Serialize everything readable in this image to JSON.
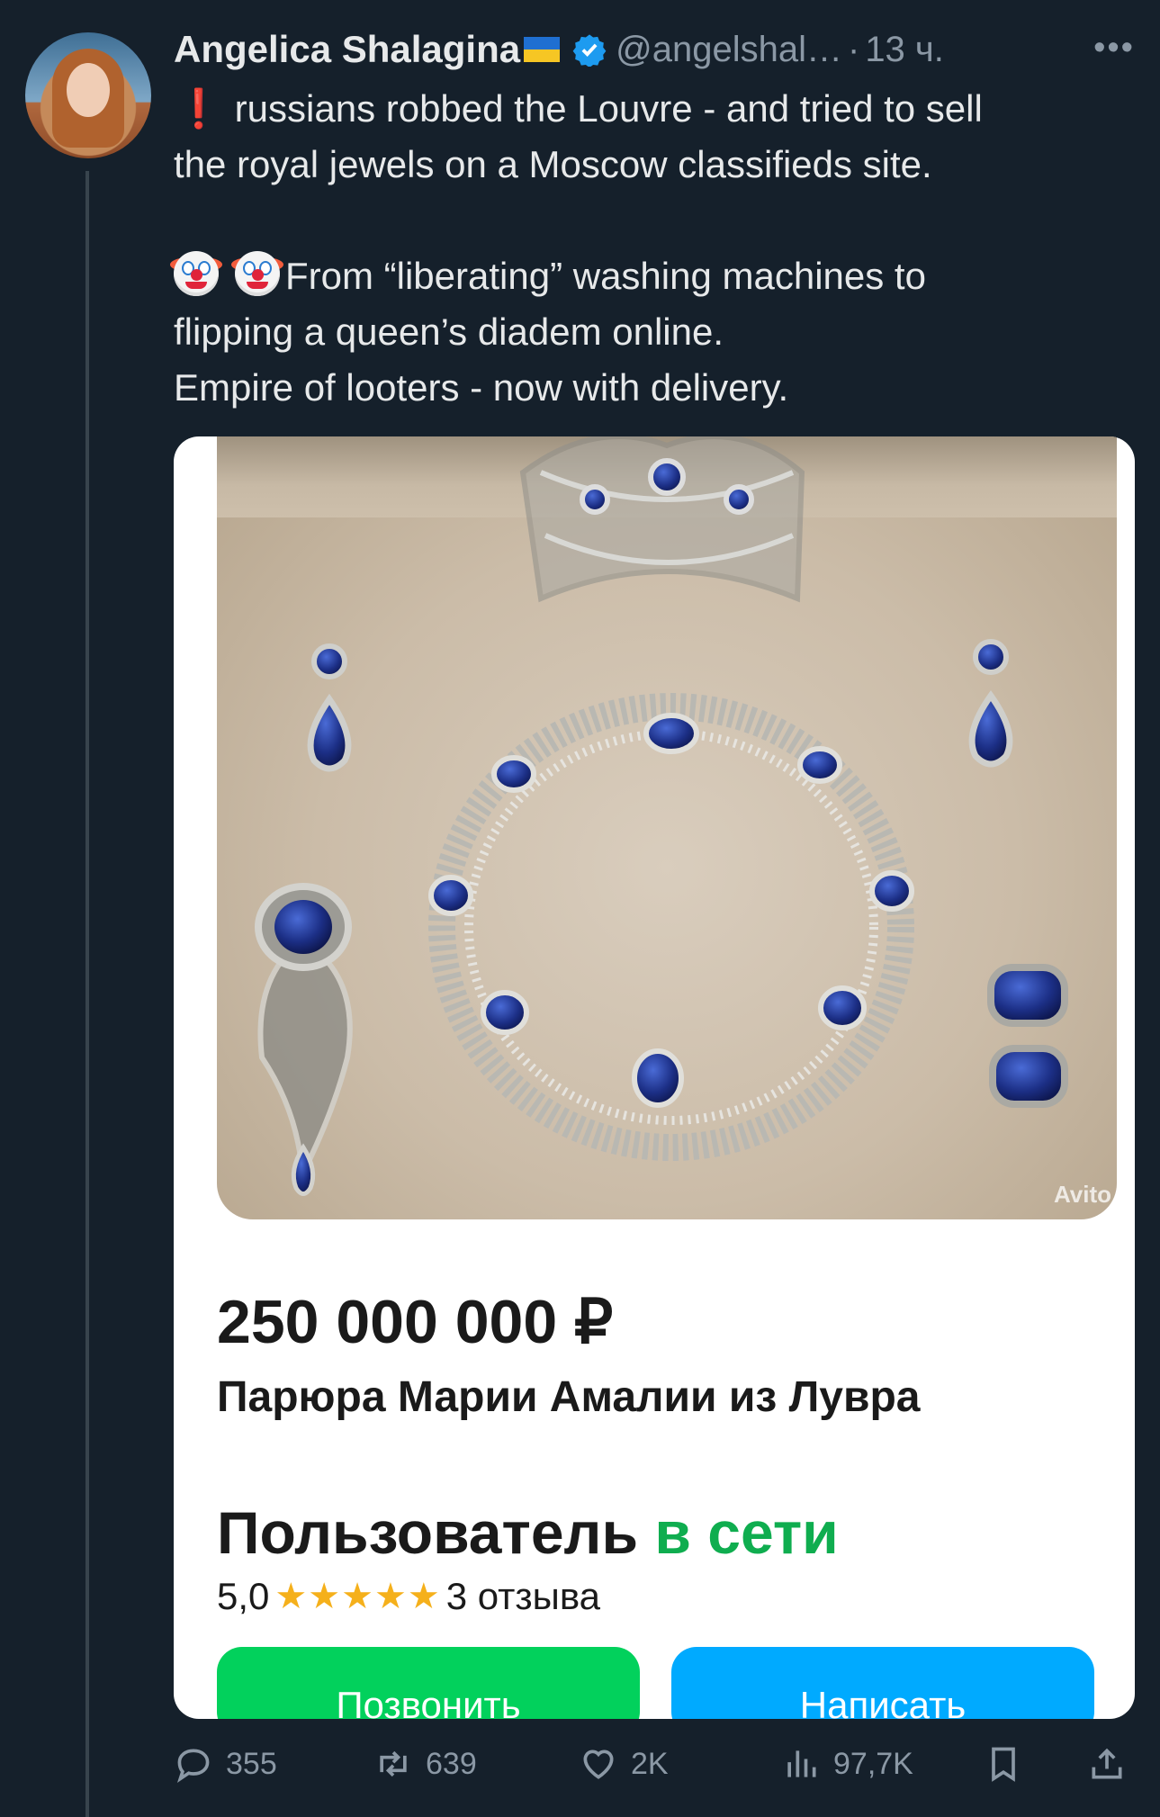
{
  "tweet": {
    "author_name": "Angelica Shalagina",
    "handle": "@angelshal…",
    "time_separator": "·",
    "time": "13 ч.",
    "more_label": "•••",
    "text": {
      "line1_emoji": "❗",
      "line1": "russians robbed the Louvre - and tried to sell",
      "line2": "the royal jewels on a Moscow classifieds site.",
      "line3": "From “liberating” washing machines to",
      "line4": "flipping a queen’s diadem online.",
      "line5": "Empire of looters - now with delivery."
    }
  },
  "listing": {
    "watermark": "Avito",
    "price": "250 000 000 ₽",
    "title": "Парюра Марии Амалии из Лувра",
    "seller_label": "Пользователь",
    "seller_status": "в сети",
    "rating_value": "5,0",
    "rating_stars": 5,
    "stars_glyphs": "★★★★★",
    "reviews": "3 отзыва",
    "call_button": "Позвонить",
    "write_button": "Написать"
  },
  "actions": {
    "replies": "355",
    "reposts": "639",
    "likes": "2K",
    "views": "97,7K"
  },
  "colors": {
    "background": "#15202b",
    "avito_green": "#02d15c",
    "avito_blue": "#00aaff",
    "online_green": "#0fad4f",
    "star": "#f5b01b"
  },
  "icons": [
    "verified-badge-icon",
    "ukraine-flag-icon",
    "more-icon",
    "reply-icon",
    "repost-icon",
    "like-icon",
    "views-icon",
    "bookmark-icon",
    "share-icon"
  ]
}
